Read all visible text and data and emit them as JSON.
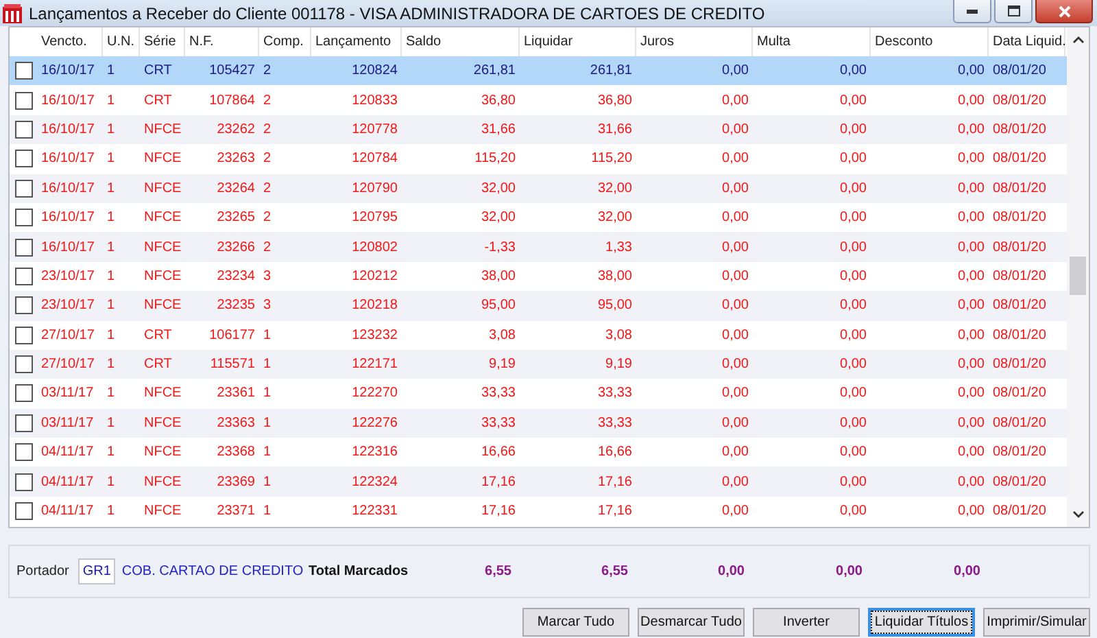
{
  "window": {
    "title": "Lançamentos a Receber do Cliente 001178 - VISA ADMINISTRADORA DE CARTOES DE CREDITO"
  },
  "table": {
    "columns": [
      "Vencto.",
      "U.N.",
      "Série",
      "N.F.",
      "Comp.",
      "Lançamento",
      "Saldo",
      "Liquidar",
      "Juros",
      "Multa",
      "Desconto",
      "Data Liquid."
    ],
    "rows": [
      {
        "checked": false,
        "selected": true,
        "cells": [
          "16/10/17",
          "1",
          "CRT",
          "105427",
          "2",
          "120824",
          "261,81",
          "261,81",
          "0,00",
          "0,00",
          "0,00",
          "08/01/20"
        ]
      },
      {
        "checked": false,
        "selected": false,
        "cells": [
          "16/10/17",
          "1",
          "CRT",
          "107864",
          "2",
          "120833",
          "36,80",
          "36,80",
          "0,00",
          "0,00",
          "0,00",
          "08/01/20"
        ]
      },
      {
        "checked": false,
        "selected": false,
        "cells": [
          "16/10/17",
          "1",
          "NFCE",
          "23262",
          "2",
          "120778",
          "31,66",
          "31,66",
          "0,00",
          "0,00",
          "0,00",
          "08/01/20"
        ]
      },
      {
        "checked": false,
        "selected": false,
        "cells": [
          "16/10/17",
          "1",
          "NFCE",
          "23263",
          "2",
          "120784",
          "115,20",
          "115,20",
          "0,00",
          "0,00",
          "0,00",
          "08/01/20"
        ]
      },
      {
        "checked": false,
        "selected": false,
        "cells": [
          "16/10/17",
          "1",
          "NFCE",
          "23264",
          "2",
          "120790",
          "32,00",
          "32,00",
          "0,00",
          "0,00",
          "0,00",
          "08/01/20"
        ]
      },
      {
        "checked": false,
        "selected": false,
        "cells": [
          "16/10/17",
          "1",
          "NFCE",
          "23265",
          "2",
          "120795",
          "32,00",
          "32,00",
          "0,00",
          "0,00",
          "0,00",
          "08/01/20"
        ]
      },
      {
        "checked": false,
        "selected": false,
        "cells": [
          "16/10/17",
          "1",
          "NFCE",
          "23266",
          "2",
          "120802",
          "-1,33",
          "1,33",
          "0,00",
          "0,00",
          "0,00",
          "08/01/20"
        ]
      },
      {
        "checked": false,
        "selected": false,
        "cells": [
          "23/10/17",
          "1",
          "NFCE",
          "23234",
          "3",
          "120212",
          "38,00",
          "38,00",
          "0,00",
          "0,00",
          "0,00",
          "08/01/20"
        ]
      },
      {
        "checked": false,
        "selected": false,
        "cells": [
          "23/10/17",
          "1",
          "NFCE",
          "23235",
          "3",
          "120218",
          "95,00",
          "95,00",
          "0,00",
          "0,00",
          "0,00",
          "08/01/20"
        ]
      },
      {
        "checked": false,
        "selected": false,
        "cells": [
          "27/10/17",
          "1",
          "CRT",
          "106177",
          "1",
          "123232",
          "3,08",
          "3,08",
          "0,00",
          "0,00",
          "0,00",
          "08/01/20"
        ]
      },
      {
        "checked": false,
        "selected": false,
        "cells": [
          "27/10/17",
          "1",
          "CRT",
          "115571",
          "1",
          "122171",
          "9,19",
          "9,19",
          "0,00",
          "0,00",
          "0,00",
          "08/01/20"
        ]
      },
      {
        "checked": false,
        "selected": false,
        "cells": [
          "03/11/17",
          "1",
          "NFCE",
          "23361",
          "1",
          "122270",
          "33,33",
          "33,33",
          "0,00",
          "0,00",
          "0,00",
          "08/01/20"
        ]
      },
      {
        "checked": false,
        "selected": false,
        "cells": [
          "03/11/17",
          "1",
          "NFCE",
          "23363",
          "1",
          "122276",
          "33,33",
          "33,33",
          "0,00",
          "0,00",
          "0,00",
          "08/01/20"
        ]
      },
      {
        "checked": false,
        "selected": false,
        "cells": [
          "04/11/17",
          "1",
          "NFCE",
          "23368",
          "1",
          "122316",
          "16,66",
          "16,66",
          "0,00",
          "0,00",
          "0,00",
          "08/01/20"
        ]
      },
      {
        "checked": false,
        "selected": false,
        "cells": [
          "04/11/17",
          "1",
          "NFCE",
          "23369",
          "1",
          "122324",
          "17,16",
          "17,16",
          "0,00",
          "0,00",
          "0,00",
          "08/01/20"
        ]
      },
      {
        "checked": false,
        "selected": false,
        "cells": [
          "04/11/17",
          "1",
          "NFCE",
          "23371",
          "1",
          "122331",
          "17,16",
          "17,16",
          "0,00",
          "0,00",
          "0,00",
          "08/01/20"
        ]
      }
    ]
  },
  "footer": {
    "portador_label": "Portador",
    "portador_code": "GR1",
    "portador_name": "COB. CARTAO DE CREDITO",
    "total_label": "Total Marcados",
    "totals": [
      "6,55",
      "6,55",
      "0,00",
      "0,00",
      "0,00"
    ]
  },
  "buttons": [
    {
      "label": "Marcar Tudo",
      "focused": false
    },
    {
      "label": "Desmarcar Tudo",
      "focused": false
    },
    {
      "label": "Inverter",
      "focused": false
    },
    {
      "label": "Liquidar Títulos",
      "focused": true
    },
    {
      "label": "Imprimir/Simular",
      "focused": false
    }
  ]
}
